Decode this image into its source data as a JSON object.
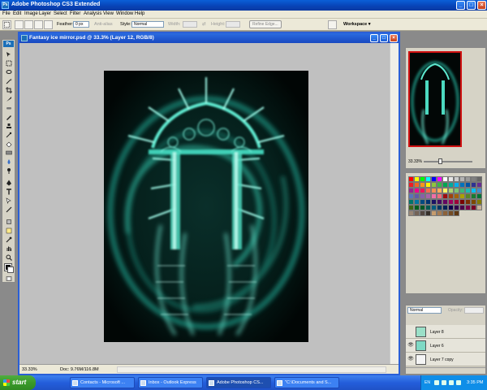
{
  "app": {
    "title": "Adobe Photoshop CS3 Extended",
    "badge": "Ps"
  },
  "menu": [
    "File",
    "Edit",
    "Image",
    "Layer",
    "Select",
    "Filter",
    "Analysis",
    "View",
    "Window",
    "Help"
  ],
  "options_bar": {
    "feather_label": "Feather:",
    "feather_value": "0 px",
    "antialias_label": "Anti-alias",
    "style_label": "Style:",
    "style_value": "Normal",
    "width_label": "Width:",
    "height_label": "Height:",
    "refine_edge_label": "Refine Edge...",
    "workspace_label": "Workspace ▾"
  },
  "document": {
    "title": "Fantasy ice mirror.psd @ 33.3% (Layer 12, RGB/8)",
    "zoom": "33.33%",
    "doc_info": "Doc: 9.76M/116.8M",
    "artwork_colors": {
      "background": "#020706",
      "glow": "#2fb8a0",
      "highlight": "#9ff7e6"
    }
  },
  "navigator": {
    "zoom": "33.33%"
  },
  "swatches": [
    "#ff0000",
    "#ffff00",
    "#00ff00",
    "#00ffff",
    "#0000ff",
    "#ff00ff",
    "#ffffff",
    "#e6e6e6",
    "#cccccc",
    "#b3b3b3",
    "#999999",
    "#808080",
    "#666666",
    "#ed1c24",
    "#f26522",
    "#f7941d",
    "#fff200",
    "#8dc63f",
    "#39b54a",
    "#00a651",
    "#00a99d",
    "#00aeef",
    "#0072bc",
    "#0054a6",
    "#2e3192",
    "#662d91",
    "#92278f",
    "#ec008c",
    "#ed145b",
    "#f26c4f",
    "#f68e56",
    "#fbaf5d",
    "#fff568",
    "#acd373",
    "#7cc576",
    "#3cb878",
    "#1cbbb4",
    "#00bff3",
    "#448ccb",
    "#5674b9",
    "#605ca8",
    "#8560a8",
    "#a863a8",
    "#f06eaa",
    "#f26d7d",
    "#9e0b0f",
    "#a0410d",
    "#a36209",
    "#aba000",
    "#598527",
    "#1a7b30",
    "#007236",
    "#00746b",
    "#0076a3",
    "#004b80",
    "#003471",
    "#1b1464",
    "#440e62",
    "#630460",
    "#9e005d",
    "#9e0039",
    "#790000",
    "#7b2e00",
    "#7d4900",
    "#827b00",
    "#406618",
    "#005e20",
    "#005826",
    "#005952",
    "#005b7f",
    "#003663",
    "#002157",
    "#0d004c",
    "#32004b",
    "#4b0049",
    "#7b0046",
    "#7a0026",
    "#c7b299",
    "#998675",
    "#736357",
    "#534741",
    "#37302a",
    "#c69c6d",
    "#a67c52",
    "#8c6239",
    "#754c24",
    "#603913"
  ],
  "layers": {
    "blend_mode": "Normal",
    "opacity_label": "Opacity:",
    "rows": [
      {
        "name": "Layer 8",
        "thumb": "#9be0c8",
        "visible": ""
      },
      {
        "name": "Layer 6",
        "thumb": "#7fd9c4",
        "visible": "👁"
      },
      {
        "name": "Layer 7 copy",
        "thumb": "#f4f4f4",
        "visible": "👁"
      }
    ]
  },
  "taskbar": {
    "start_label": "start",
    "tasks": [
      "Contacts - Microsoft ...",
      "Inbox - Outlook Express",
      "Adobe Photoshop CS...",
      "\"C:\\Documents and S..."
    ],
    "lang": "EN",
    "clock": "3:35 PM"
  }
}
